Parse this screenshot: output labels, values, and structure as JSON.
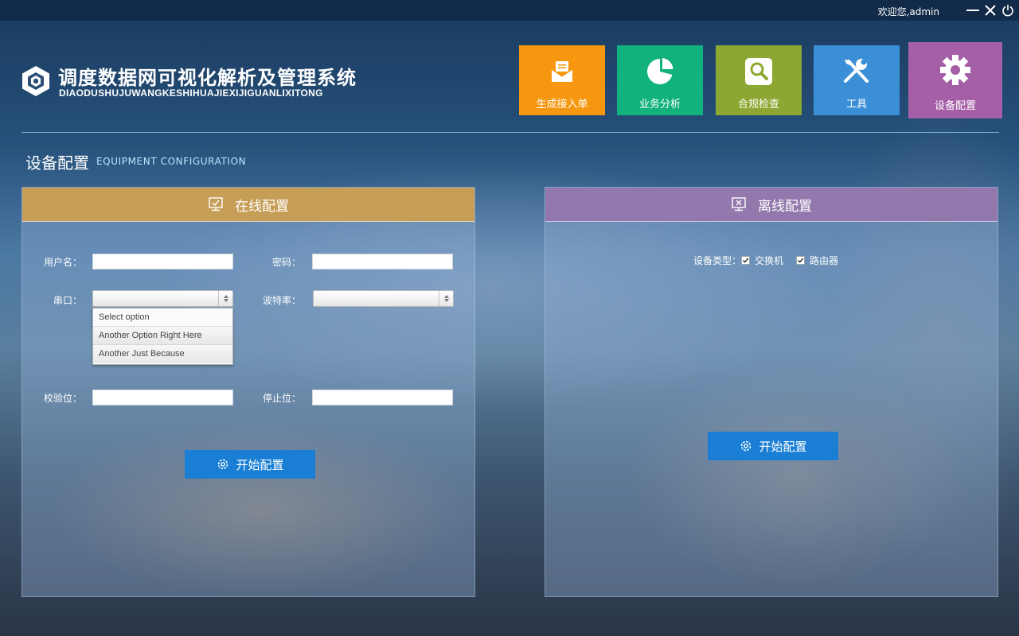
{
  "window": {
    "welcome_text": "欢迎您,admin"
  },
  "app": {
    "title": "调度数据网可视化解析及管理系统",
    "subtitle": "DIAODUSHUJUWANGKESHIHUAJIEXIJIGUANLIXITONG"
  },
  "nav": {
    "tiles": [
      {
        "label": "生成接入单",
        "icon": "envelope-icon",
        "color": "#f6970f"
      },
      {
        "label": "业务分析",
        "icon": "pie-chart-icon",
        "color": "#12b27f"
      },
      {
        "label": "合规检查",
        "icon": "search-icon",
        "color": "#8da832"
      },
      {
        "label": "工具",
        "icon": "tools-icon",
        "color": "#3b8fd6"
      },
      {
        "label": "设备配置",
        "icon": "gear-icon",
        "color": "#a55fa7",
        "active": true
      }
    ]
  },
  "page": {
    "title": "设备配置",
    "subtitle": "EQUIPMENT CONFIGURATION"
  },
  "online": {
    "header": "在线配置",
    "username_label": "用户名：",
    "username_value": "",
    "password_label": "密码：",
    "password_value": "",
    "serial_label": "串口：",
    "serial_value": "",
    "serial_options": [
      "Select option",
      "Another Option Right Here",
      "Another Just Because"
    ],
    "baud_label": "波特率：",
    "baud_value": "",
    "parity_label": "校验位：",
    "parity_value": "",
    "stopbit_label": "停止位：",
    "stopbit_value": "",
    "start_button": "开始配置"
  },
  "offline": {
    "header": "离线配置",
    "device_type_label": "设备类型：",
    "options": [
      {
        "label": "交换机",
        "checked": true
      },
      {
        "label": "路由器",
        "checked": true
      }
    ],
    "start_button": "开始配置"
  }
}
